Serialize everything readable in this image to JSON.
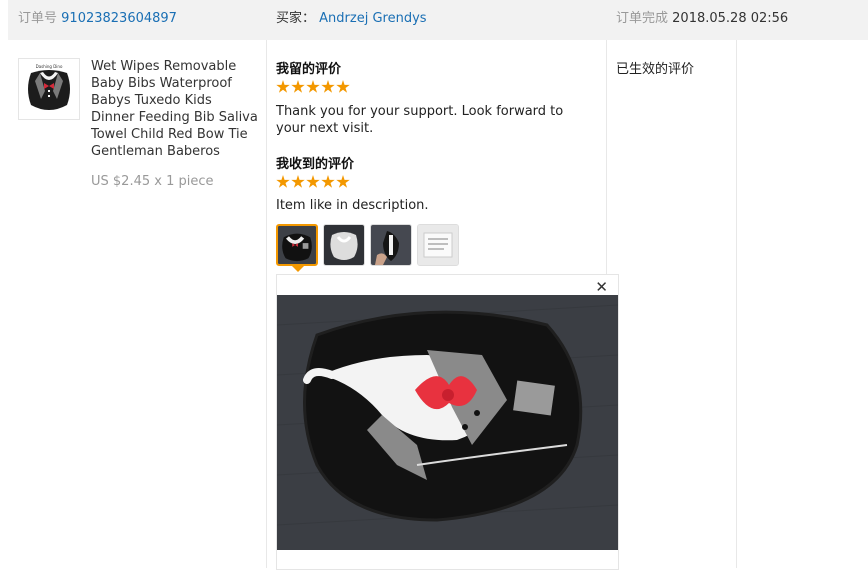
{
  "header": {
    "order_label": "订单号",
    "order_number": "91023823604897",
    "buyer_label": "买家：",
    "buyer_name": "Andrzej Grendys",
    "status_label": "订单完成",
    "completed_time": "2018.05.28 02:56"
  },
  "product": {
    "title": "Wet Wipes Removable Baby Bibs Waterproof Babys Tuxedo Kids Dinner Feeding Bib Saliva Towel Child Red Bow Tie Gentleman Baberos",
    "price": "US $2.45 x 1 piece",
    "thumb_caption": "Dashing Dino"
  },
  "my_review": {
    "title": "我留的评价",
    "rating": 5,
    "text": "Thank you for your support. Look forward to your next visit."
  },
  "received_review": {
    "title": "我收到的评价",
    "rating": 5,
    "text": "Item like in description.",
    "photos": [
      "bib-on-dark-fabric",
      "bib-front-view",
      "bib-in-hand",
      "bib-label-close-up"
    ],
    "active_photo": 0
  },
  "review_status": "已生效的评价",
  "preview": {
    "close_symbol": "✕"
  },
  "colors": {
    "header_bg": "#f2f2f2",
    "link": "#1a6fb4",
    "star": "#f39800",
    "muted": "#999999"
  }
}
